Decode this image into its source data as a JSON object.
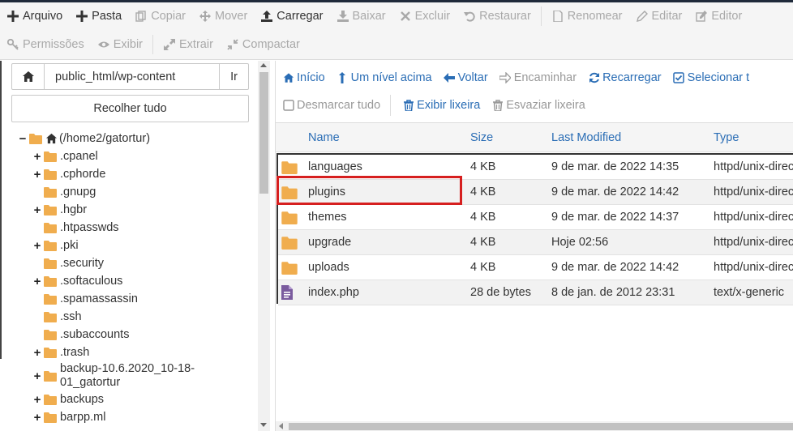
{
  "toolbar": {
    "row1": [
      {
        "label": "Arquivo",
        "icon": "plus-icon",
        "enabled": true
      },
      {
        "label": "Pasta",
        "icon": "plus-icon",
        "enabled": true
      },
      {
        "label": "Copiar",
        "icon": "copy-icon",
        "enabled": false
      },
      {
        "label": "Mover",
        "icon": "move-icon",
        "enabled": false
      },
      {
        "label": "Carregar",
        "icon": "upload-icon",
        "enabled": true
      },
      {
        "label": "Baixar",
        "icon": "download-icon",
        "enabled": false
      },
      {
        "label": "Excluir",
        "icon": "close-icon",
        "enabled": false
      },
      {
        "label": "Restaurar",
        "icon": "undo-icon",
        "enabled": false
      },
      {
        "label": "Renomear",
        "icon": "file-icon",
        "enabled": false
      },
      {
        "label": "Editar",
        "icon": "pencil-icon",
        "enabled": false
      },
      {
        "label": "Editor",
        "icon": "edit-icon",
        "enabled": false
      }
    ],
    "row2": [
      {
        "label": "Permissões",
        "icon": "key-icon",
        "enabled": false
      },
      {
        "label": "Exibir",
        "icon": "eye-icon",
        "enabled": false
      },
      {
        "label": "Extrair",
        "icon": "expand-icon",
        "enabled": false
      },
      {
        "label": "Compactar",
        "icon": "compress-icon",
        "enabled": false
      }
    ]
  },
  "sidebar": {
    "path_value": "public_html/wp-content",
    "go_label": "Ir",
    "collapse_label": "Recolher tudo",
    "tree": [
      {
        "label": "(/home2/gatortur)",
        "toggle": "−",
        "home": true
      },
      {
        "label": ".cpanel",
        "toggle": "+"
      },
      {
        "label": ".cphorde",
        "toggle": "+"
      },
      {
        "label": ".gnupg",
        "toggle": ""
      },
      {
        "label": ".hgbr",
        "toggle": "+"
      },
      {
        "label": ".htpasswds",
        "toggle": ""
      },
      {
        "label": ".pki",
        "toggle": "+"
      },
      {
        "label": ".security",
        "toggle": ""
      },
      {
        "label": ".softaculous",
        "toggle": "+"
      },
      {
        "label": ".spamassassin",
        "toggle": ""
      },
      {
        "label": ".ssh",
        "toggle": ""
      },
      {
        "label": ".subaccounts",
        "toggle": ""
      },
      {
        "label": ".trash",
        "toggle": "+"
      },
      {
        "label": "backup-10.6.2020_10-18-01_gatortur",
        "toggle": "+"
      },
      {
        "label": "backups",
        "toggle": "+"
      },
      {
        "label": "barpp.ml",
        "toggle": "+"
      }
    ]
  },
  "nav": {
    "row1": [
      {
        "label": "Início",
        "icon": "home-icon",
        "enabled": true
      },
      {
        "label": "Um nível acima",
        "icon": "level-up-icon",
        "enabled": true
      },
      {
        "label": "Voltar",
        "icon": "arrow-left-icon",
        "enabled": true
      },
      {
        "label": "Encaminhar",
        "icon": "arrow-right-icon",
        "enabled": false
      },
      {
        "label": "Recarregar",
        "icon": "refresh-icon",
        "enabled": true
      },
      {
        "label": "Selecionar t",
        "icon": "checkbox-checked-icon",
        "enabled": true
      }
    ],
    "row2": [
      {
        "label": "Desmarcar tudo",
        "icon": "checkbox-empty-icon",
        "enabled": false
      },
      {
        "label": "Exibir lixeira",
        "icon": "trash-icon",
        "enabled": true
      },
      {
        "label": "Esvaziar lixeira",
        "icon": "trash-icon",
        "enabled": false
      }
    ]
  },
  "table": {
    "headers": {
      "name": "Name",
      "size": "Size",
      "modified": "Last Modified",
      "type": "Type"
    },
    "rows": [
      {
        "icon": "folder-icon",
        "name": "languages",
        "size": "4 KB",
        "modified": "9 de mar. de 2022 14:35",
        "type": "httpd/unix-directory"
      },
      {
        "icon": "folder-icon",
        "name": "plugins",
        "size": "4 KB",
        "modified": "9 de mar. de 2022 14:42",
        "type": "httpd/unix-directory"
      },
      {
        "icon": "folder-icon",
        "name": "themes",
        "size": "4 KB",
        "modified": "9 de mar. de 2022 14:37",
        "type": "httpd/unix-directory"
      },
      {
        "icon": "folder-icon",
        "name": "upgrade",
        "size": "4 KB",
        "modified": "Hoje 02:56",
        "type": "httpd/unix-directory"
      },
      {
        "icon": "folder-icon",
        "name": "uploads",
        "size": "4 KB",
        "modified": "9 de mar. de 2022 14:42",
        "type": "httpd/unix-directory"
      },
      {
        "icon": "php-file-icon",
        "name": "index.php",
        "size": "28 de bytes",
        "modified": "8 de jan. de 2012 23:31",
        "type": "text/x-generic"
      }
    ]
  },
  "colors": {
    "accent": "#2a6db5",
    "folder": "#f0ad4e",
    "highlight": "#d61f1f"
  }
}
